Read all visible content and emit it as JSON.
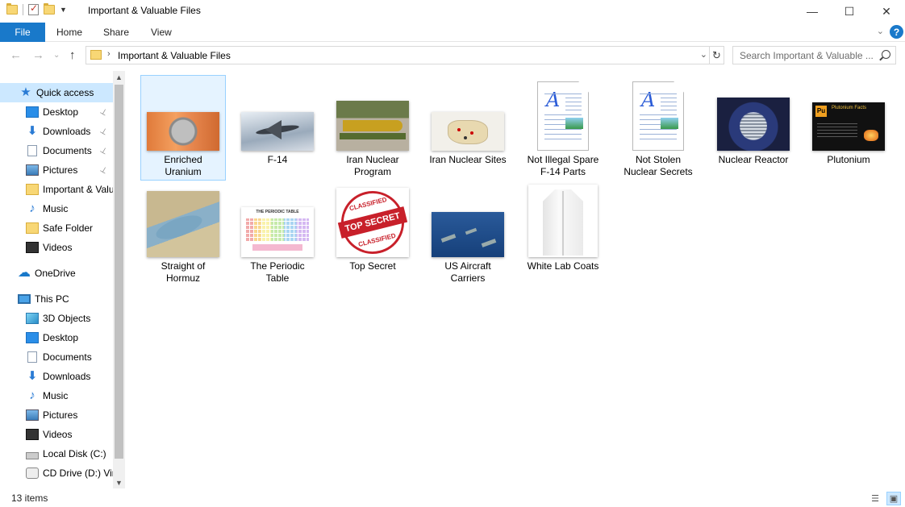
{
  "window": {
    "title": "Important & Valuable Files",
    "minimize_glyph": "—",
    "maximize_glyph": "☐",
    "close_glyph": "✕"
  },
  "ribbon": {
    "tabs": [
      "File",
      "Home",
      "Share",
      "View"
    ],
    "help_glyph": "?",
    "expand_glyph": "⌄"
  },
  "address": {
    "back_glyph": "←",
    "forward_glyph": "→",
    "recent_glyph": "⌄",
    "up_glyph": "↑",
    "sep_glyph": "›",
    "path": "Important & Valuable Files",
    "dropdown_glyph": "⌄",
    "refresh_glyph": "↻",
    "search_placeholder": "Search Important & Valuable ..."
  },
  "nav": {
    "items": [
      {
        "label": "Quick access",
        "icon": "star-icon",
        "pinned": false
      },
      {
        "label": "Desktop",
        "icon": "desktop-icon",
        "pinned": true
      },
      {
        "label": "Downloads",
        "icon": "download-icon",
        "pinned": true
      },
      {
        "label": "Documents",
        "icon": "documents-icon",
        "pinned": true
      },
      {
        "label": "Pictures",
        "icon": "pictures-icon",
        "pinned": true
      },
      {
        "label": "Important & Valuable Files",
        "icon": "folder-icon",
        "pinned": false
      },
      {
        "label": "Music",
        "icon": "music-icon",
        "pinned": false
      },
      {
        "label": "Safe Folder",
        "icon": "folder-icon",
        "pinned": false
      },
      {
        "label": "Videos",
        "icon": "videos-icon",
        "pinned": false
      },
      {
        "label": "OneDrive",
        "icon": "onedrive-icon",
        "pinned": false
      },
      {
        "label": "This PC",
        "icon": "this-pc-icon",
        "pinned": false
      },
      {
        "label": "3D Objects",
        "icon": "3d-objects-icon",
        "pinned": false
      },
      {
        "label": "Desktop",
        "icon": "desktop-icon",
        "pinned": false
      },
      {
        "label": "Documents",
        "icon": "documents-icon",
        "pinned": false
      },
      {
        "label": "Downloads",
        "icon": "download-icon",
        "pinned": false
      },
      {
        "label": "Music",
        "icon": "music-icon",
        "pinned": false
      },
      {
        "label": "Pictures",
        "icon": "pictures-icon",
        "pinned": false
      },
      {
        "label": "Videos",
        "icon": "videos-icon",
        "pinned": false
      },
      {
        "label": "Local Disk (C:)",
        "icon": "local-disk-icon",
        "pinned": false
      },
      {
        "label": "CD Drive (D:) VirtualBox Guest Additions",
        "icon": "cd-drive-icon",
        "pinned": false
      }
    ],
    "pin_glyph": "📌",
    "scroll_up_glyph": "▲",
    "scroll_down_glyph": "▼"
  },
  "files": [
    {
      "line1": "Enriched",
      "line2": "Uranium",
      "kind": "photo",
      "selected": true
    },
    {
      "line1": "F-14",
      "line2": "",
      "kind": "photo",
      "selected": false
    },
    {
      "line1": "Iran Nuclear",
      "line2": "Program",
      "kind": "photo",
      "selected": false
    },
    {
      "line1": "Iran Nuclear Sites",
      "line2": "",
      "kind": "photo",
      "selected": false
    },
    {
      "line1": "Not Illegal Spare",
      "line2": "F-14 Parts",
      "kind": "document",
      "selected": false
    },
    {
      "line1": "Not Stolen",
      "line2": "Nuclear Secrets",
      "kind": "document",
      "selected": false
    },
    {
      "line1": "Nuclear Reactor",
      "line2": "",
      "kind": "photo",
      "selected": false
    },
    {
      "line1": "Plutonium",
      "line2": "",
      "kind": "photo",
      "selected": false
    },
    {
      "line1": "Straight of",
      "line2": "Hormuz",
      "kind": "photo",
      "selected": false
    },
    {
      "line1": "The Periodic",
      "line2": "Table",
      "kind": "photo",
      "selected": false
    },
    {
      "line1": "Top Secret",
      "line2": "",
      "kind": "photo",
      "selected": false
    },
    {
      "line1": "US Aircraft",
      "line2": "Carriers",
      "kind": "photo",
      "selected": false
    },
    {
      "line1": "White Lab Coats",
      "line2": "",
      "kind": "photo",
      "selected": false
    }
  ],
  "thumb_text": {
    "periodic_title": "THE PERIODIC TABLE",
    "stamp_top": "CLASSIFIED",
    "stamp_mid": "TOP SECRET",
    "stamp_bottom": "CLASSIFIED",
    "plutonium_title": "Plutonium Facts",
    "plutonium_symbol": "Pu",
    "doc_letter": "A"
  },
  "status": {
    "count": "13 items"
  },
  "colors": {
    "accent": "#1979ca",
    "selection": "#cce8ff",
    "selection_border": "#99d1ff"
  }
}
